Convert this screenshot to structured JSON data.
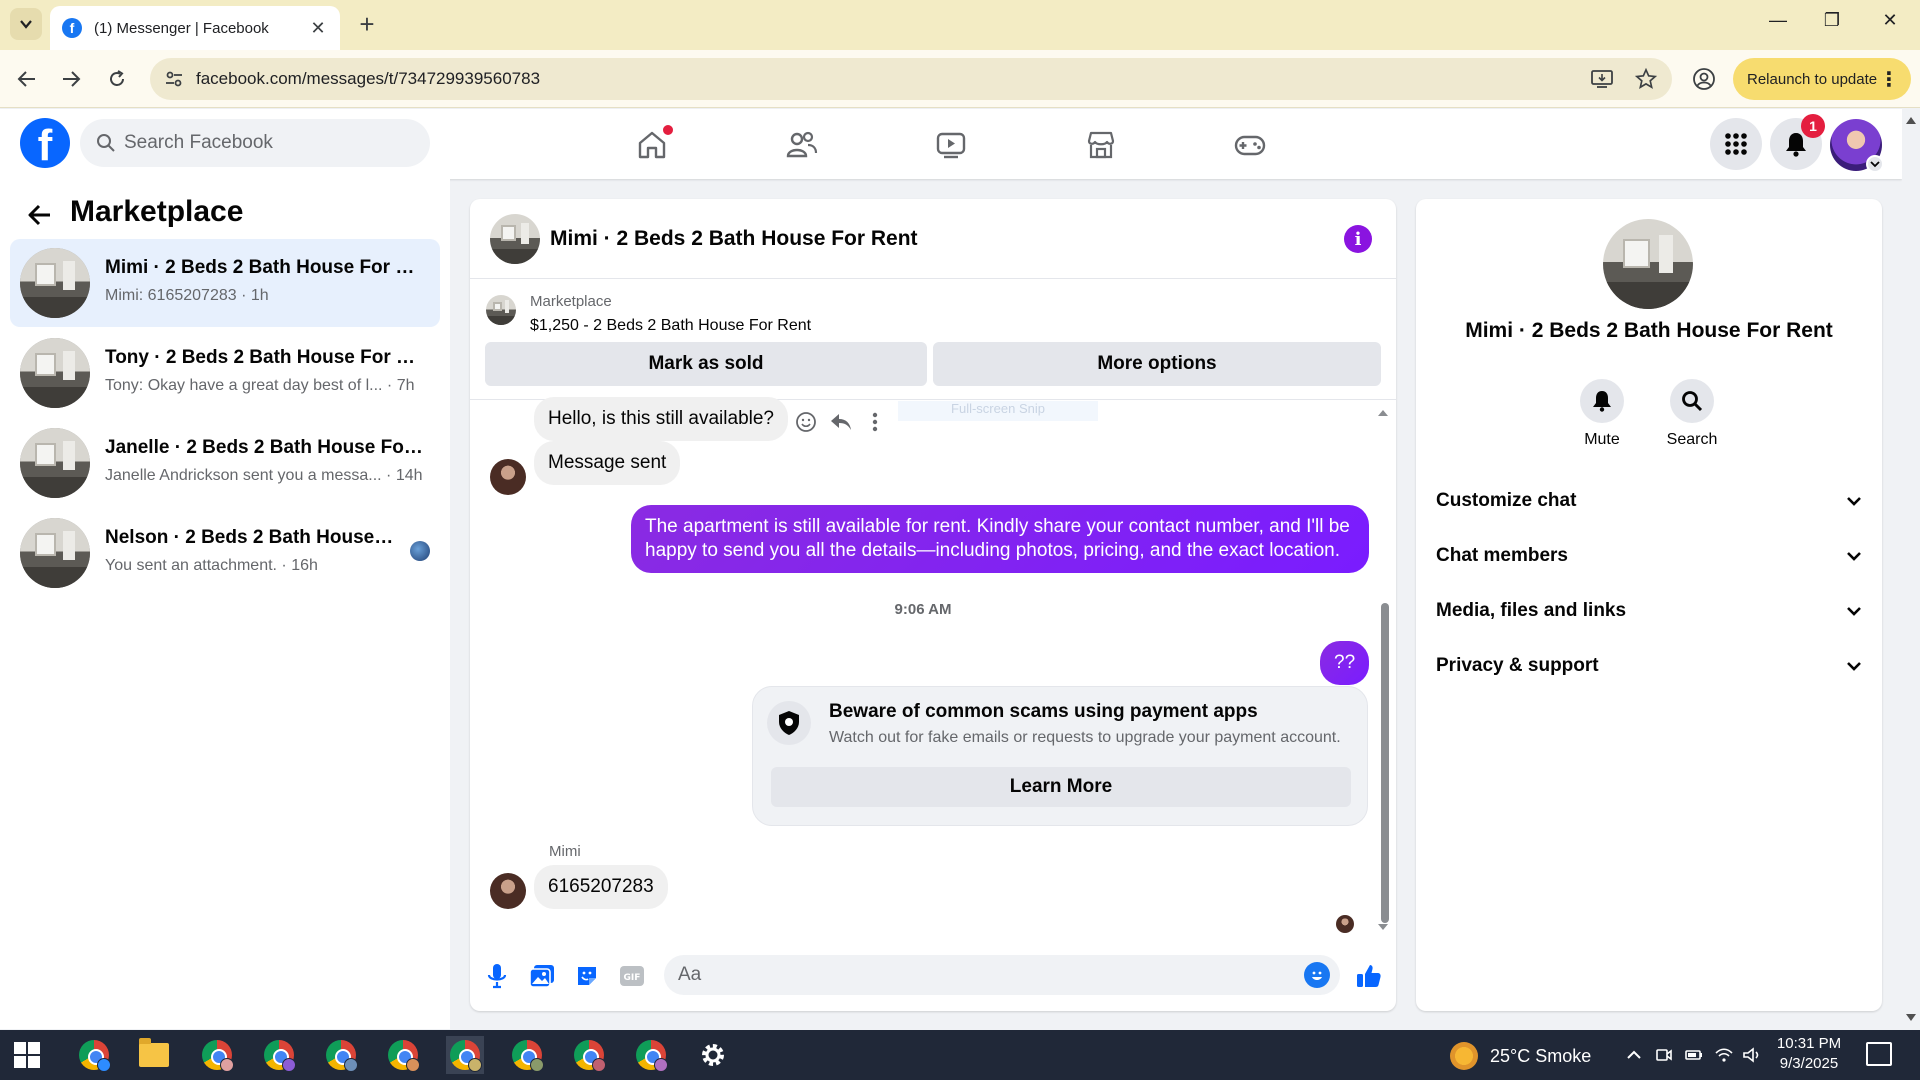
{
  "browser": {
    "tab_title": "(1) Messenger | Facebook",
    "url": "facebook.com/messages/t/734729939560783",
    "relaunch_label": "Relaunch to update"
  },
  "fb": {
    "search_placeholder": "Search Facebook",
    "notification_count": "1"
  },
  "sidebar": {
    "title": "Marketplace",
    "conversations": [
      {
        "name": "Mimi · 2 Beds 2 Bath House For Rent",
        "snippet": "Mimi: 6165207283 · 1h",
        "active": true
      },
      {
        "name": "Tony · 2 Beds 2 Bath House For Rent",
        "snippet": "Tony: Okay have a great day best of l... · 7h"
      },
      {
        "name": "Janelle · 2 Beds 2 Bath House For Rent",
        "snippet": "Janelle Andrickson sent you a messa... · 14h"
      },
      {
        "name": "Nelson · 2 Beds 2 Bath House For Rent",
        "snippet": "You sent an attachment. · 16h"
      }
    ]
  },
  "chat": {
    "title": "Mimi · 2 Beds 2 Bath House For Rent",
    "marketplace_label": "Marketplace",
    "listing": "$1,250 - 2 Beds 2 Bath House For Rent",
    "mark_sold_label": "Mark as sold",
    "more_options_label": "More options",
    "ghost_chip": "Full-screen Snip",
    "messages": {
      "m1": "Hello, is this still available?",
      "m2": "Message sent",
      "m3": "The apartment is still available for rent. Kindly share your contact number, and I'll be happy to send you all the details—including photos, pricing, and the exact location.",
      "time": "9:06 AM",
      "m4": "??",
      "sender": "Mimi",
      "m5": "6165207283"
    },
    "warning": {
      "title": "Beware of common scams using payment apps",
      "desc": "Watch out for fake emails or requests to upgrade your payment account.",
      "button": "Learn More"
    },
    "composer_placeholder": "Aa"
  },
  "info_panel": {
    "name": "Mimi · 2 Beds 2 Bath House For Rent",
    "mute_label": "Mute",
    "search_label": "Search",
    "sections": [
      "Customize chat",
      "Chat members",
      "Media, files and links",
      "Privacy & support"
    ]
  },
  "taskbar": {
    "weather": "25°C  Smoke",
    "time": "10:31 PM",
    "date": "9/3/2025"
  },
  "colors": {
    "fb_blue": "#0866ff",
    "outgoing_bubble": "#8125ff",
    "active_conv_bg": "#e7f0fd",
    "relaunch_bg": "#f7dc6f"
  }
}
